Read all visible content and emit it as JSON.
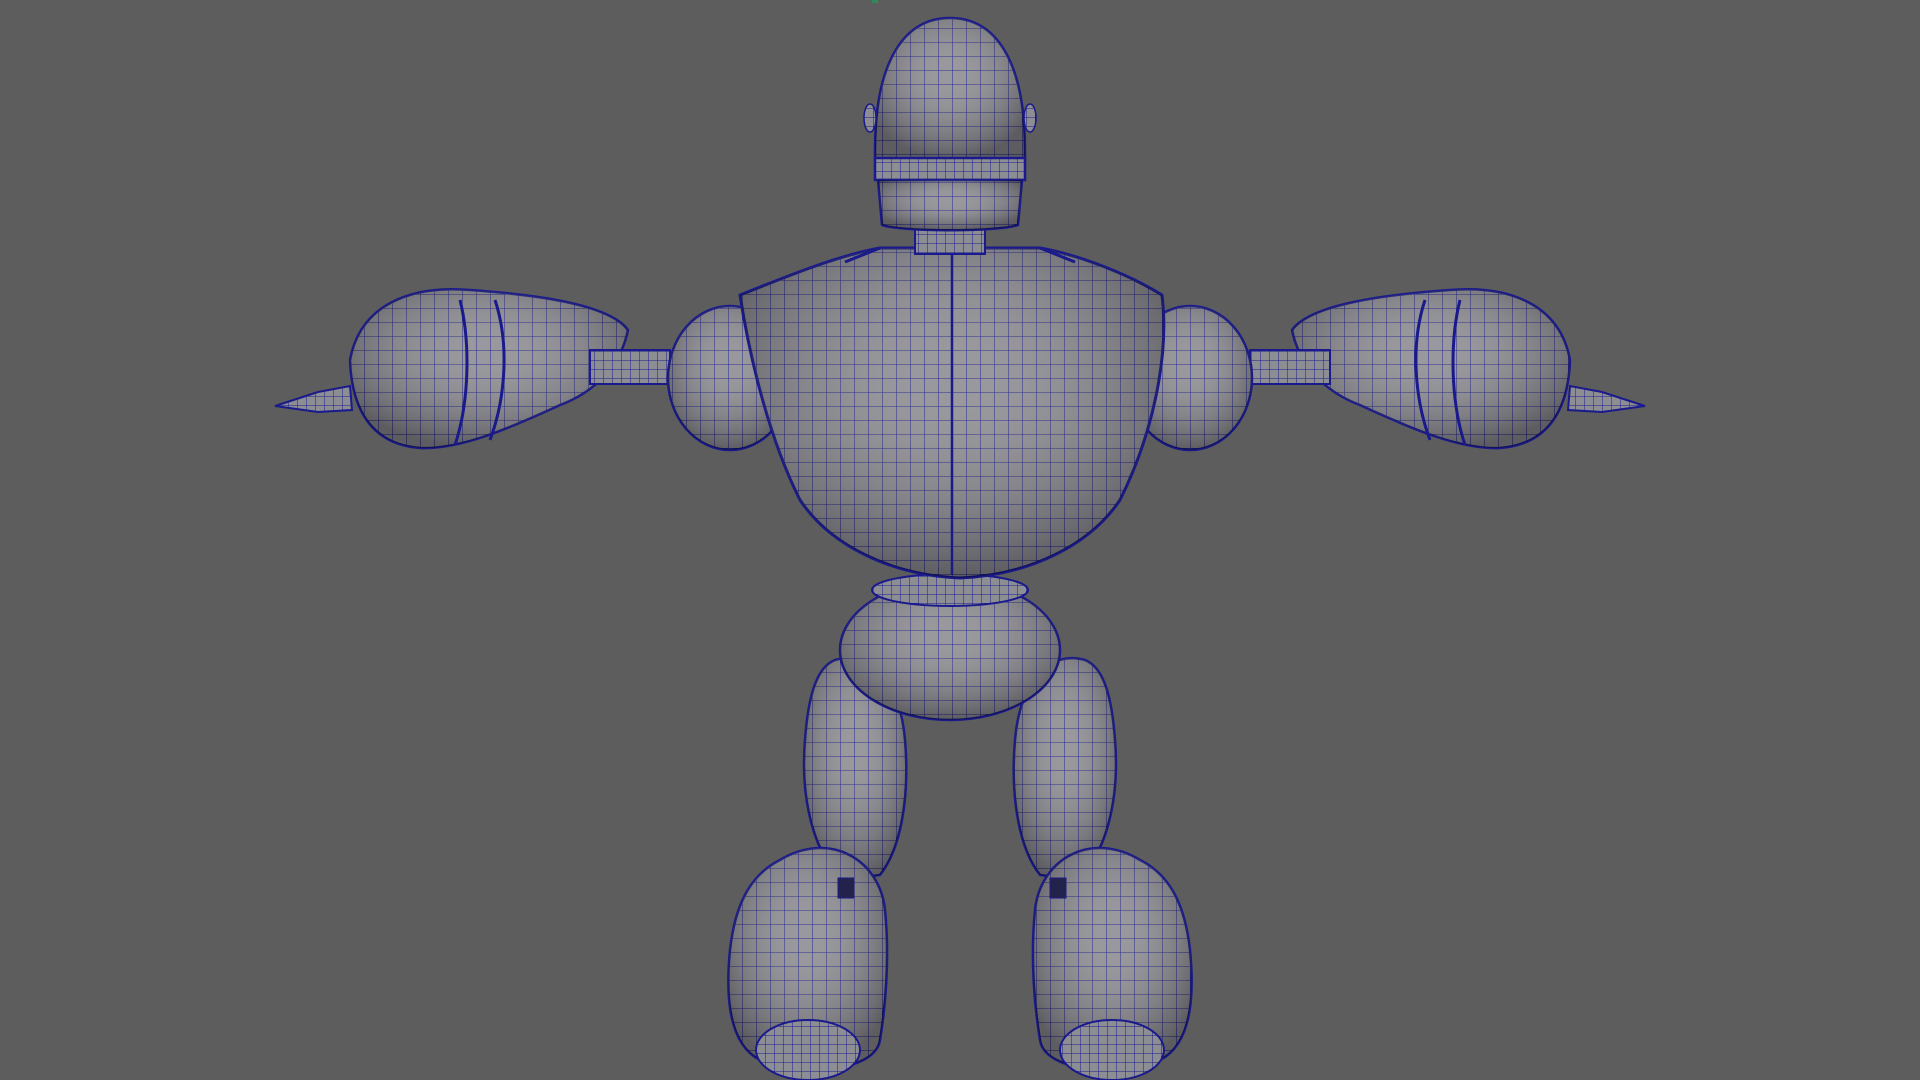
{
  "viewport": {
    "background_color": "#5d5d5d",
    "shading": "wireframe-on-shaded",
    "mesh_fill_color": "#8f8f95",
    "wire_color": "#1a1a8c",
    "view": "back-orthographic"
  },
  "model": {
    "parts": [
      "head",
      "neck",
      "torso",
      "pelvis",
      "left-shoulder",
      "right-shoulder",
      "left-arm-joint",
      "right-arm-joint",
      "left-forearm",
      "right-forearm",
      "left-leg",
      "right-leg",
      "left-foot",
      "right-foot"
    ]
  }
}
